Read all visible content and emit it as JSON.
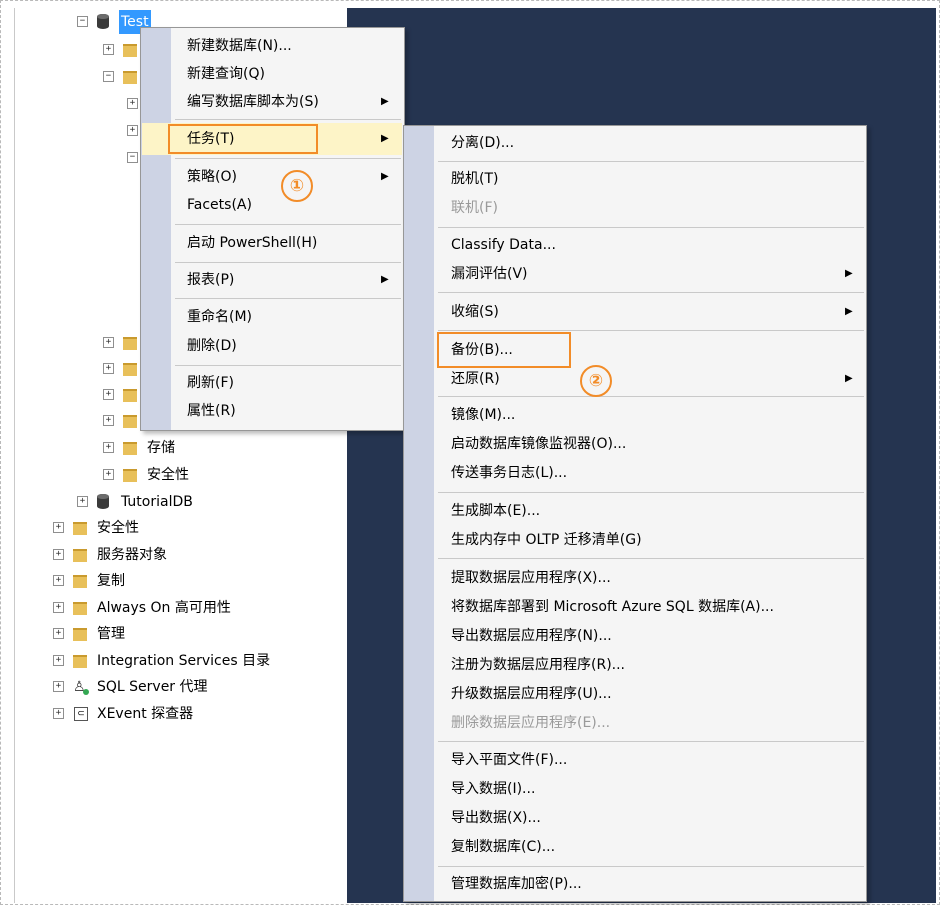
{
  "tree": {
    "test_db": "Test",
    "storage": "存储",
    "security_inner": "安全性",
    "tutorialdb": "TutorialDB",
    "security": "安全性",
    "server_objects": "服务器对象",
    "replication": "复制",
    "always_on": "Always On 高可用性",
    "management": "管理",
    "integration_services": "Integration Services 目录",
    "sql_agent": "SQL Server 代理",
    "xevent": "XEvent 探查器"
  },
  "context_menu": {
    "items": [
      {
        "label": "新建数据库(N)..."
      },
      {
        "label": "新建查询(Q)"
      },
      {
        "label": "编写数据库脚本为(S)"
      },
      {
        "label": "任务(T)"
      },
      {
        "label": "策略(O)"
      },
      {
        "label": "Facets(A)"
      },
      {
        "label": "启动 PowerShell(H)"
      },
      {
        "label": "报表(P)"
      },
      {
        "label": "重命名(M)"
      },
      {
        "label": "删除(D)"
      },
      {
        "label": "刷新(F)"
      },
      {
        "label": "属性(R)"
      }
    ]
  },
  "tasks_menu": {
    "items": [
      {
        "label": "分离(D)..."
      },
      {
        "label": "脱机(T)"
      },
      {
        "label": "联机(F)"
      },
      {
        "label": "Classify Data..."
      },
      {
        "label": "漏洞评估(V)"
      },
      {
        "label": "收缩(S)"
      },
      {
        "label": "备份(B)..."
      },
      {
        "label": "还原(R)"
      },
      {
        "label": "镜像(M)..."
      },
      {
        "label": "启动数据库镜像监视器(O)..."
      },
      {
        "label": "传送事务日志(L)..."
      },
      {
        "label": "生成脚本(E)..."
      },
      {
        "label": "生成内存中 OLTP 迁移清单(G)"
      },
      {
        "label": "提取数据层应用程序(X)..."
      },
      {
        "label": "将数据库部署到 Microsoft Azure SQL 数据库(A)..."
      },
      {
        "label": "导出数据层应用程序(N)..."
      },
      {
        "label": "注册为数据层应用程序(R)..."
      },
      {
        "label": "升级数据层应用程序(U)..."
      },
      {
        "label": "删除数据层应用程序(E)..."
      },
      {
        "label": "导入平面文件(F)..."
      },
      {
        "label": "导入数据(I)..."
      },
      {
        "label": "导出数据(X)..."
      },
      {
        "label": "复制数据库(C)..."
      },
      {
        "label": "管理数据库加密(P)..."
      }
    ]
  },
  "annotations": {
    "step1": "①",
    "step2": "②"
  },
  "colors": {
    "highlight": "#f28c28",
    "dark_panel": "#253450",
    "selection": "#3399ff"
  }
}
